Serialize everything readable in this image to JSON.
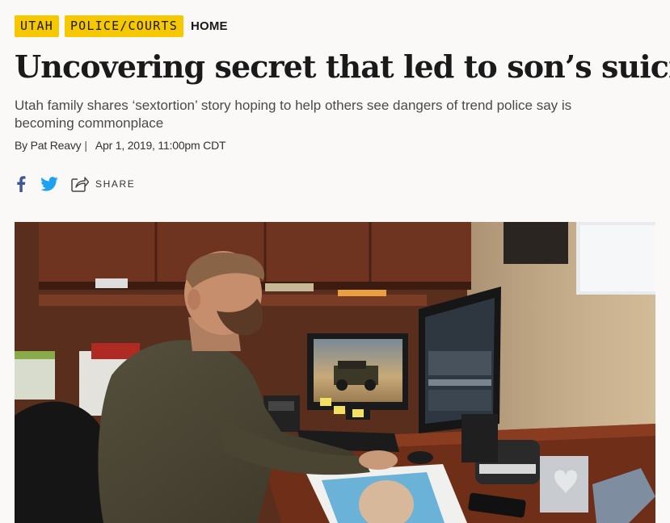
{
  "article": {
    "tags": [
      {
        "label": "UTAH"
      },
      {
        "label": "POLICE/COURTS"
      }
    ],
    "section": "HOME",
    "headline": "Uncovering secret that led to son’s suicide",
    "dek": "Utah family shares ‘sextortion’ story hoping to help others see dangers of trend police say is becoming commonplace",
    "byline": {
      "author": "By Pat Reavy",
      "separator": "|",
      "date": "Apr 1, 2019, 11:00pm CDT"
    },
    "share": {
      "label": "SHARE",
      "icons": [
        "facebook-icon",
        "twitter-icon",
        "share-icon"
      ]
    }
  },
  "colors": {
    "tag_bg": "#f5c800",
    "facebook": "#3b5998",
    "twitter": "#1da1f2",
    "text": "#1a1a1a",
    "dek": "#4a4a4a"
  }
}
